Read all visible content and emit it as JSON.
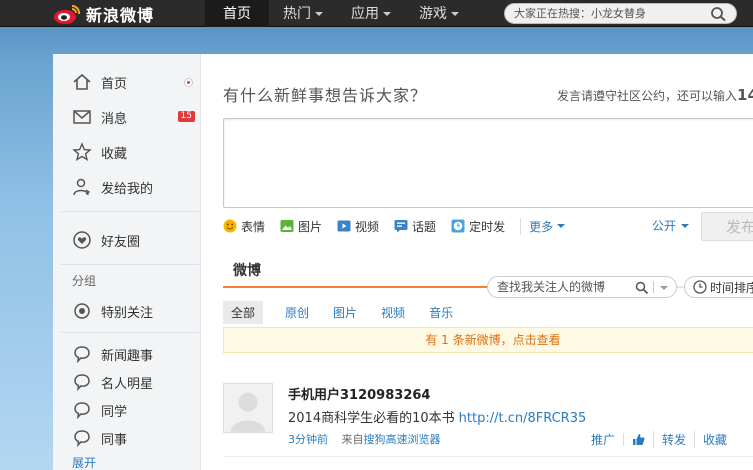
{
  "header": {
    "logo_text": "新浪微博",
    "nav": [
      {
        "label": "首页",
        "active": true
      },
      {
        "label": "热门",
        "has_caret": true
      },
      {
        "label": "应用",
        "has_caret": true
      },
      {
        "label": "游戏",
        "has_caret": true
      }
    ],
    "search_placeholder": "大家正在热搜：小龙女替身",
    "search_icon": "search-icon"
  },
  "sidebar": {
    "items": [
      {
        "label": "首页",
        "icon": "home-icon"
      },
      {
        "label": "消息",
        "icon": "mail-icon",
        "badge": "15"
      },
      {
        "label": "收藏",
        "icon": "star-icon"
      },
      {
        "label": "发给我的",
        "icon": "user-send-icon"
      },
      {
        "label": "好友圈",
        "icon": "heart-icon"
      }
    ],
    "group_label": "分组",
    "special": {
      "label": "特别关注",
      "icon": "target-icon"
    },
    "groups": [
      {
        "label": "新闻趣事"
      },
      {
        "label": "名人明星"
      },
      {
        "label": "同学"
      },
      {
        "label": "同事"
      }
    ],
    "expand_label": "展开"
  },
  "composer": {
    "prompt": "有什么新鲜事想告诉大家？",
    "notice_prefix": "发言请遵守社区公约，还可以输入",
    "notice_count": "14",
    "tools": [
      {
        "label": "表情",
        "icon": "smile-icon"
      },
      {
        "label": "图片",
        "icon": "image-icon"
      },
      {
        "label": "视频",
        "icon": "video-icon"
      },
      {
        "label": "话题",
        "icon": "topic-icon"
      },
      {
        "label": "定时发",
        "icon": "clock-icon"
      }
    ],
    "more_label": "更多",
    "visibility_label": "公开",
    "send_label": "发布"
  },
  "feed": {
    "tab_label": "微博",
    "search_placeholder": "查找我关注人的微博",
    "time_sort_label": "时间排序",
    "subtabs": [
      "全部",
      "原创",
      "图片",
      "视频",
      "音乐"
    ],
    "new_notice": "有 1 条新微博，点击查看",
    "post": {
      "author": "手机用户3120983264",
      "text": "2014商科学生必看的10本书",
      "link": "http://t.cn/8FRCR35",
      "time": "3分钟前",
      "source_prefix": "来自",
      "source": "搜狗高速浏览器",
      "actions": {
        "promote": "推广",
        "repost": "转发",
        "favorite": "收藏"
      }
    }
  },
  "colors": {
    "accent_orange": "#fa7d3c",
    "link_blue": "#2a7cc1",
    "badge_red": "#e23a3a",
    "topbar": "#2b2b2b"
  }
}
